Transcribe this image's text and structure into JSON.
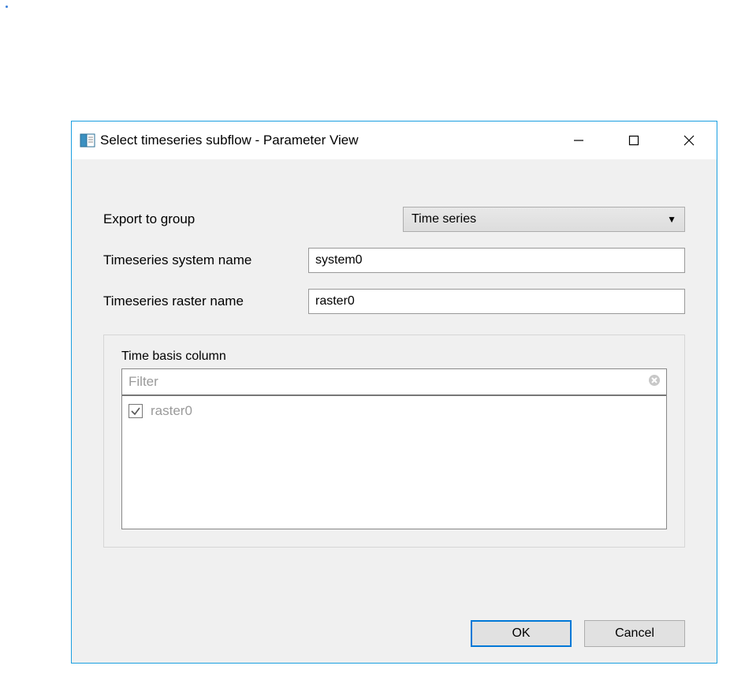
{
  "window": {
    "title": "Select timeseries subflow - Parameter View"
  },
  "form": {
    "export_to_group_label": "Export to group",
    "export_to_group_value": "Time series",
    "system_name_label": "Timeseries system name",
    "system_name_value": "system0",
    "raster_name_label": "Timeseries raster name",
    "raster_name_value": "raster0"
  },
  "group": {
    "label": "Time basis column",
    "filter_placeholder": "Filter",
    "items": [
      {
        "label": "raster0",
        "checked": true
      }
    ]
  },
  "buttons": {
    "ok": "OK",
    "cancel": "Cancel"
  }
}
